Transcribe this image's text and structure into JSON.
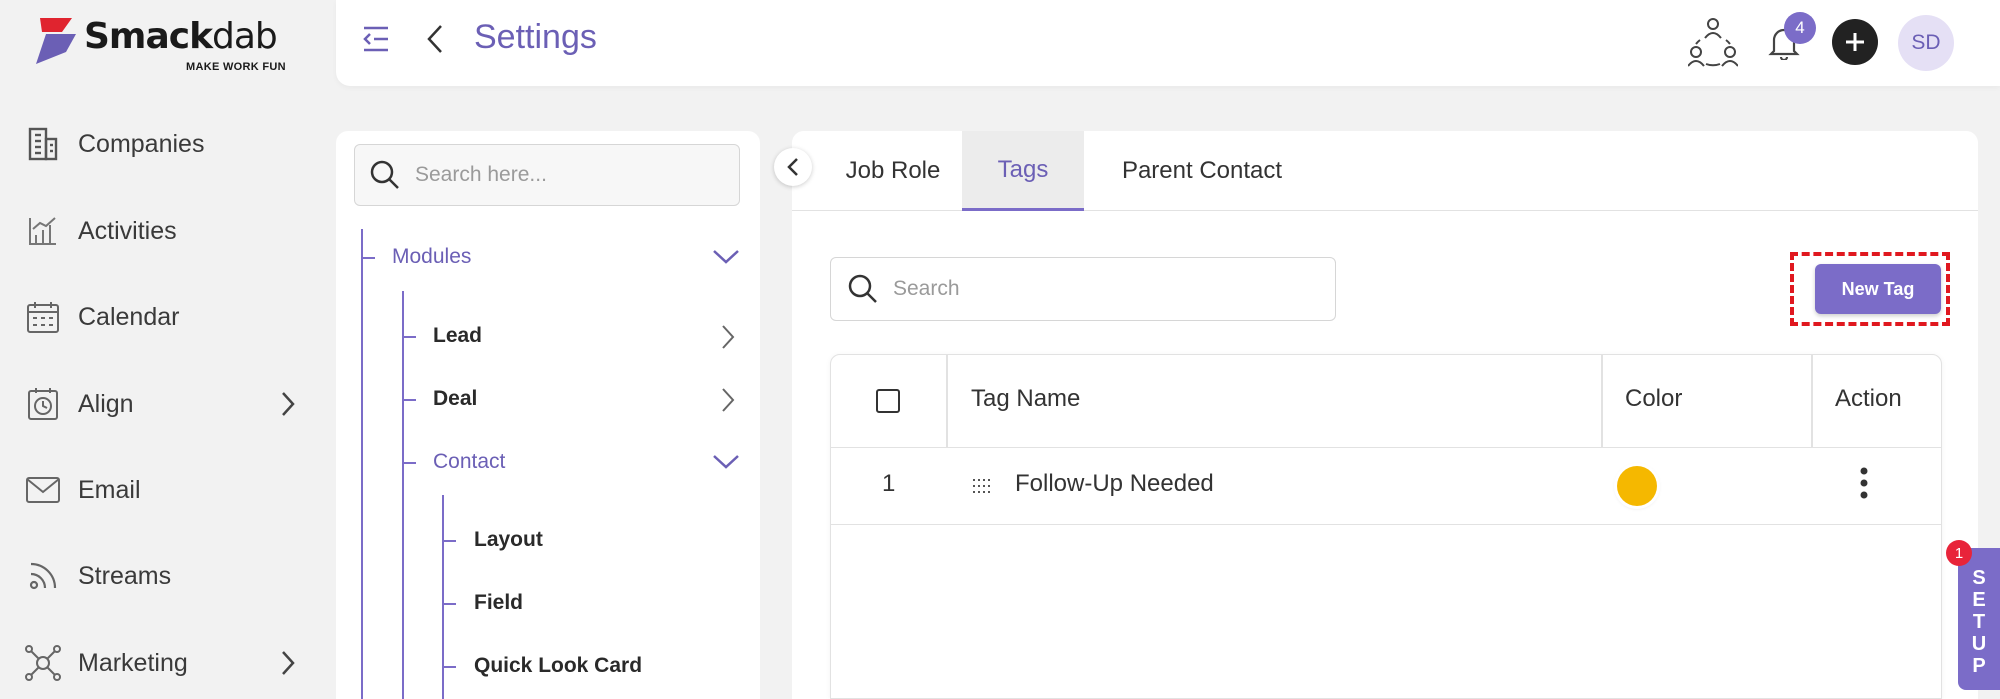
{
  "app": {
    "brand_name_bold": "Smack",
    "brand_name_light": "dab",
    "tagline": "MAKE WORK FUN",
    "accent_color": "#7b6cc8"
  },
  "sidebar": {
    "items": [
      {
        "label": "Companies",
        "icon": "building-icon",
        "has_submenu": false
      },
      {
        "label": "Activities",
        "icon": "chart-icon",
        "has_submenu": false
      },
      {
        "label": "Calendar",
        "icon": "calendar-icon",
        "has_submenu": false
      },
      {
        "label": "Align",
        "icon": "clock-board-icon",
        "has_submenu": true
      },
      {
        "label": "Email",
        "icon": "envelope-icon",
        "has_submenu": false
      },
      {
        "label": "Streams",
        "icon": "rss-icon",
        "has_submenu": false
      },
      {
        "label": "Marketing",
        "icon": "network-icon",
        "has_submenu": true
      }
    ]
  },
  "header": {
    "title": "Settings",
    "notification_count": "4",
    "avatar_initials": "SD"
  },
  "tree": {
    "search_placeholder": "Search here...",
    "nodes": {
      "modules": "Modules",
      "lead": "Lead",
      "deal": "Deal",
      "contact": "Contact",
      "layout": "Layout",
      "field": "Field",
      "quick_look_card": "Quick Look Card"
    }
  },
  "tabs": [
    {
      "label": "Job Role",
      "active": false
    },
    {
      "label": "Tags",
      "active": true
    },
    {
      "label": "Parent Contact",
      "active": false
    }
  ],
  "tags": {
    "search_placeholder": "Search",
    "new_button_label": "New Tag",
    "columns": [
      "Tag Name",
      "Color",
      "Action"
    ],
    "rows": [
      {
        "index": "1",
        "name": "Follow-Up Needed",
        "color": "#f5b800"
      }
    ]
  },
  "setup": {
    "label_letters": [
      "S",
      "E",
      "T",
      "U",
      "P"
    ],
    "badge_count": "1"
  }
}
